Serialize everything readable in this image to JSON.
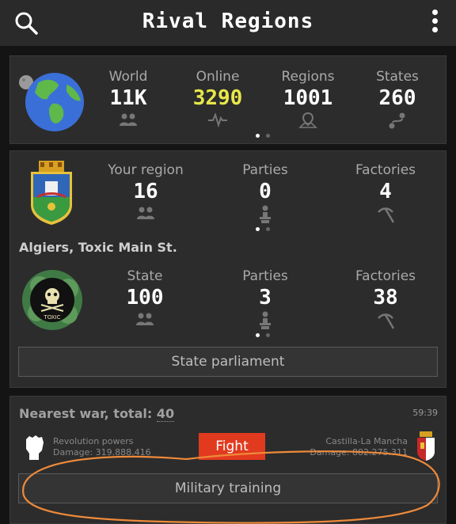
{
  "app": {
    "title": "Rival Regions"
  },
  "world_stats": [
    {
      "label": "World",
      "value": "11K",
      "icon": "people-icon"
    },
    {
      "label": "Online",
      "value": "3290",
      "icon": "pulse-icon",
      "highlight": "#e7e74a"
    },
    {
      "label": "Regions",
      "value": "1001",
      "icon": "map-pin-icon"
    },
    {
      "label": "States",
      "value": "260",
      "icon": "route-icon"
    }
  ],
  "region": {
    "stats": [
      {
        "label": "Your region",
        "value": "16",
        "icon": "people-icon"
      },
      {
        "label": "Parties",
        "value": "0",
        "icon": "party-icon"
      },
      {
        "label": "Factories",
        "value": "4",
        "icon": "pickaxe-icon"
      }
    ],
    "location": "Algiers, Toxic Main St.",
    "state_stats": [
      {
        "label": "State",
        "value": "100",
        "icon": "people-icon"
      },
      {
        "label": "Parties",
        "value": "3",
        "icon": "party-icon"
      },
      {
        "label": "Factories",
        "value": "38",
        "icon": "pickaxe-icon"
      }
    ],
    "emblem_text": "TOXIC",
    "parliament_button": "State parliament"
  },
  "war": {
    "title": "Nearest war, total:",
    "total": "40",
    "timer": "59:39",
    "left_name": "Revolution powers",
    "left_damage": "Damage: 319.888.416",
    "right_name": "Castilla-La Mancha",
    "right_damage": "Damage: 882.275.311",
    "fight_button": "Fight",
    "training_button": "Military training"
  },
  "colors": {
    "accent": "#e7e74a",
    "fight": "#e23a1e",
    "annotation": "#ee8a3a"
  }
}
